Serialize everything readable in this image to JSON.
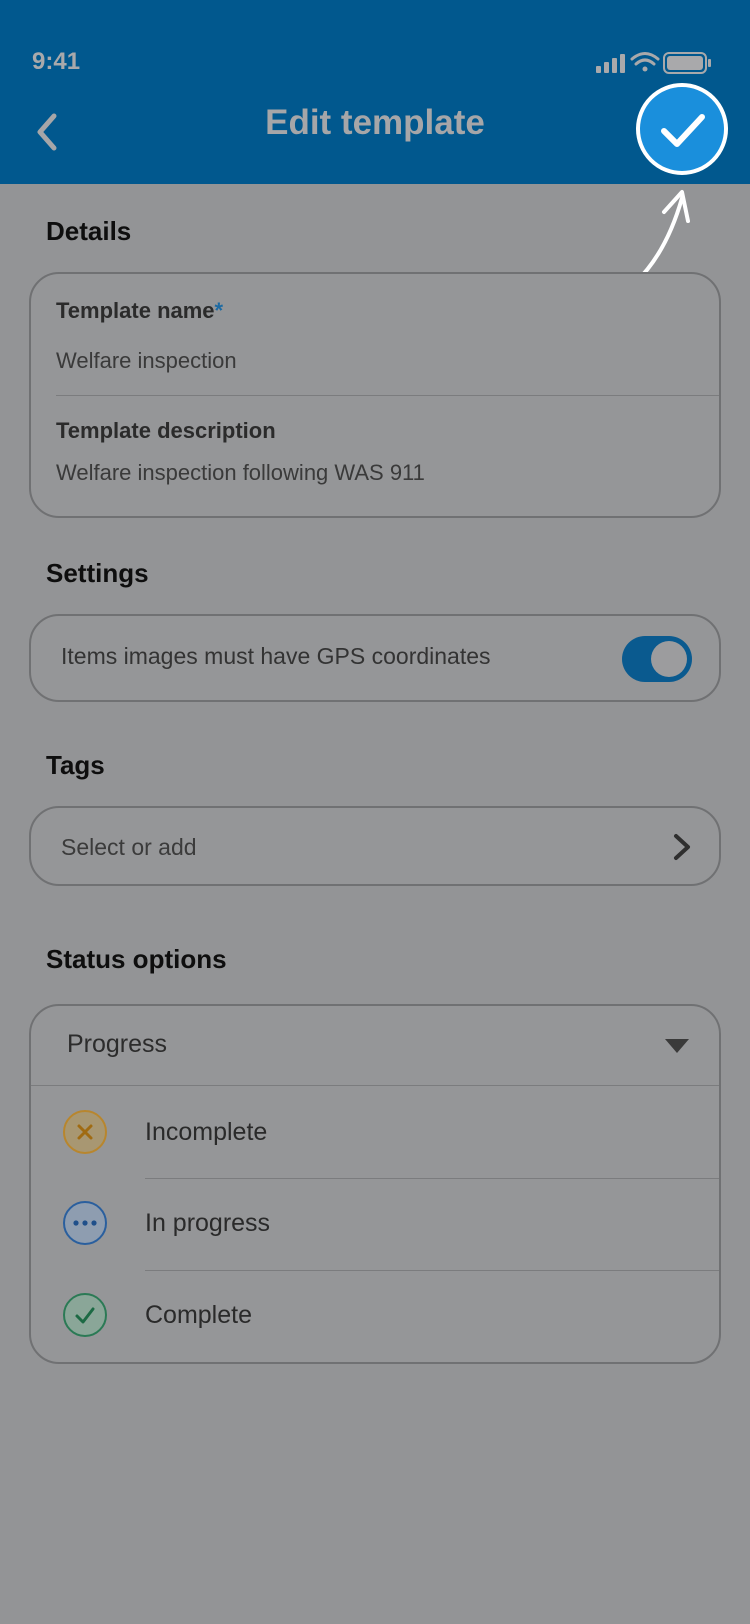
{
  "status_bar": {
    "time": "9:41"
  },
  "header": {
    "title": "Edit template"
  },
  "details": {
    "section_title": "Details",
    "name_label": "Template name",
    "required_marker": "*",
    "name_value": "Welfare inspection",
    "description_label": "Template description",
    "description_value": "Welfare inspection following WAS 911"
  },
  "settings": {
    "section_title": "Settings",
    "gps_label": "Items images must have GPS coordinates",
    "gps_enabled": true
  },
  "tags": {
    "section_title": "Tags",
    "placeholder": "Select or add"
  },
  "status_options": {
    "section_title": "Status options",
    "group_label": "Progress",
    "items": [
      {
        "label": "Incomplete",
        "icon": "x-icon",
        "color": "#c89a3a"
      },
      {
        "label": "In progress",
        "icon": "ellipsis-icon",
        "color": "#2a64a8"
      },
      {
        "label": "Complete",
        "icon": "check-icon",
        "color": "#2b7a55"
      }
    ]
  },
  "colors": {
    "header_bg": "#01588e",
    "accent": "#1a8fdc",
    "overlay_bg": "#939496"
  }
}
